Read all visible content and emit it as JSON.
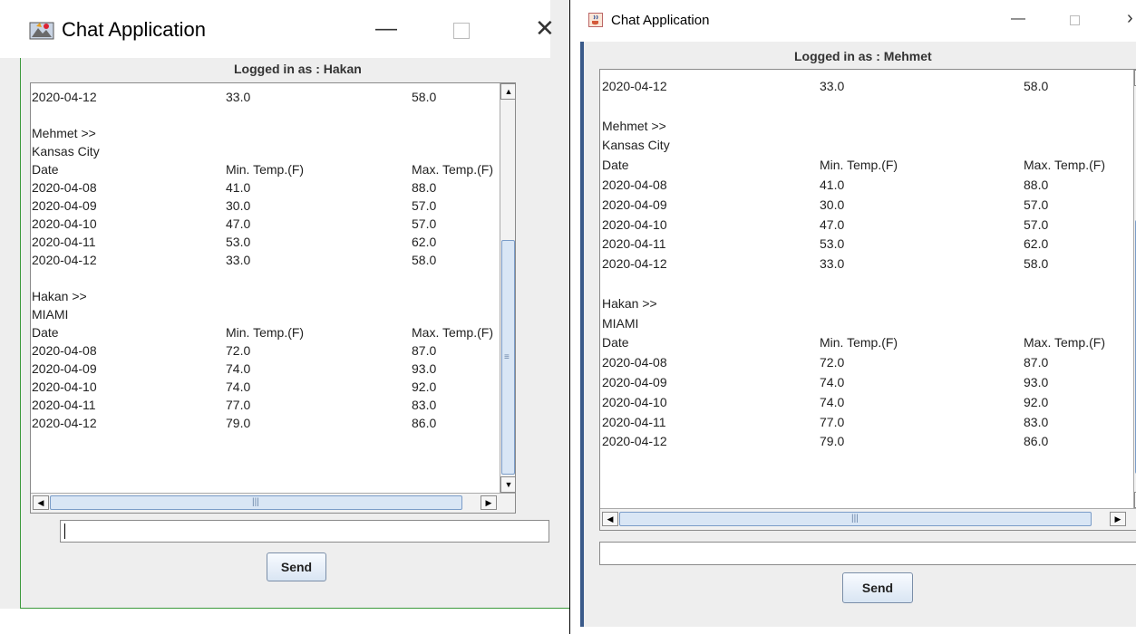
{
  "windows": [
    {
      "title": "Chat Application",
      "logged_in": "Logged in as : Hakan",
      "send_label": "Send",
      "message_value": "",
      "controls": {
        "minimize": "—",
        "close": "✕"
      }
    },
    {
      "title": "Chat Application",
      "logged_in": "Logged in as : Mehmet",
      "send_label": "Send",
      "message_value": "",
      "controls": {
        "minimize": "—",
        "close": "›"
      }
    }
  ],
  "chat_lines": [
    [
      "2020-04-12",
      "33.0",
      "58.0"
    ],
    [
      ""
    ],
    [
      "Mehmet >>"
    ],
    [
      "Kansas City"
    ],
    [
      "Date",
      "Min. Temp.(F)",
      "Max. Temp.(F)"
    ],
    [
      "2020-04-08",
      "41.0",
      "88.0"
    ],
    [
      "2020-04-09",
      "30.0",
      "57.0"
    ],
    [
      "2020-04-10",
      "47.0",
      "57.0"
    ],
    [
      "2020-04-11",
      "53.0",
      "62.0"
    ],
    [
      "2020-04-12",
      "33.0",
      "58.0"
    ],
    [
      ""
    ],
    [
      "Hakan >>"
    ],
    [
      "MIAMI"
    ],
    [
      "Date",
      "Min. Temp.(F)",
      "Max. Temp.(F)"
    ],
    [
      "2020-04-08",
      "72.0",
      "87.0"
    ],
    [
      "2020-04-09",
      "74.0",
      "93.0"
    ],
    [
      "2020-04-10",
      "74.0",
      "92.0"
    ],
    [
      "2020-04-11",
      "77.0",
      "83.0"
    ],
    [
      "2020-04-12",
      "79.0",
      "86.0"
    ]
  ],
  "scroll": {
    "left_vertical_position": 0.62,
    "right_vertical_position": 0.6,
    "horizontal_position": 0.0
  },
  "colors": {
    "window_bg": "#eeeeee",
    "scroll_thumb": "#d9e6f5",
    "send_button": "#d9e5f3",
    "frame_border_left": "#3c9a3c"
  },
  "icons": {
    "app_icon_left": "java-app-icon",
    "app_icon_right": "java-cup-icon",
    "scroll_up": "triangle-up",
    "scroll_down": "triangle-down",
    "scroll_left": "triangle-left",
    "scroll_right": "triangle-right"
  }
}
